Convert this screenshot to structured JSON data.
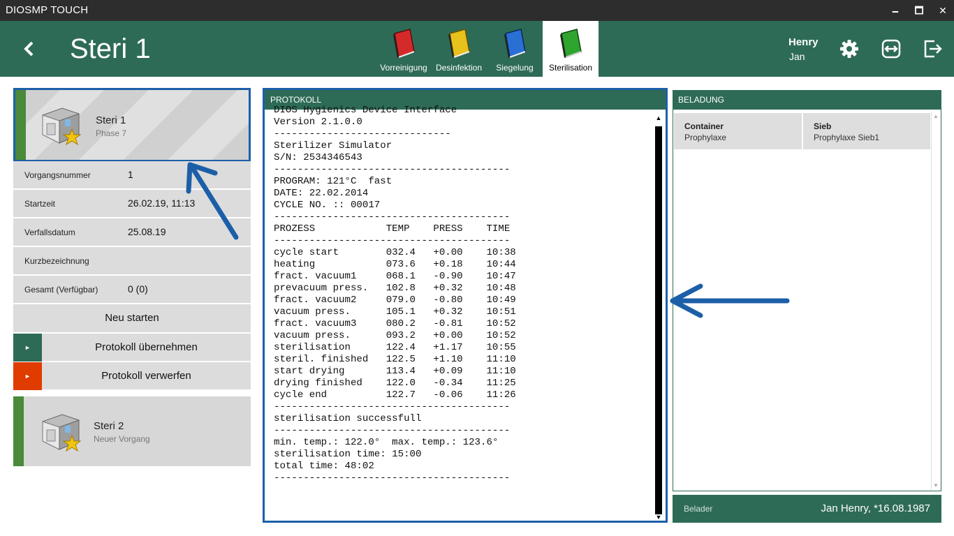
{
  "window": {
    "title": "DIOSMP TOUCH",
    "min": "🗕",
    "max": "🗖",
    "close": "✕"
  },
  "header": {
    "title": "Steri 1",
    "tabs": [
      {
        "label": "Vorreinigung",
        "color": "#d42a2a"
      },
      {
        "label": "Desinfektion",
        "color": "#e8c21c"
      },
      {
        "label": "Siegelung",
        "color": "#2a6fd4"
      },
      {
        "label": "Sterilisation",
        "color": "#2fa52f"
      }
    ],
    "user": {
      "first": "Henry",
      "last": "Jan"
    }
  },
  "left": {
    "card1": {
      "name": "Steri 1",
      "sub": "Phase 7"
    },
    "rows": [
      {
        "key": "Vorgangsnummer",
        "value": "1"
      },
      {
        "key": "Startzeit",
        "value": "26.02.19, 11:13"
      },
      {
        "key": "Verfallsdatum",
        "value": "25.08.19"
      },
      {
        "key": "Kurzbezeichnung",
        "value": ""
      },
      {
        "key": "Gesamt (Verfügbar)",
        "value": "0 (0)"
      }
    ],
    "restart": "Neu starten",
    "accept": "Protokoll übernehmen",
    "discard": "Protokoll verwerfen",
    "play": "►",
    "card2": {
      "name": "Steri 2",
      "sub": "Neuer Vorgang"
    }
  },
  "protokoll": {
    "title": "PROTOKOLL",
    "text": "DIOS Hygienics Device Interface\nVersion 2.1.0.0\n------------------------------\nSterilizer Simulator\nS/N: 2534346543\n----------------------------------------\nPROGRAM: 121°C  fast\nDATE: 22.02.2014\nCYCLE NO. :: 00017\n----------------------------------------\nPROZESS            TEMP    PRESS    TIME\n----------------------------------------\ncycle start        032.4   +0.00    10:38\nheating            073.6   +0.18    10:44\nfract. vacuum1     068.1   -0.90    10:47\nprevacuum press.   102.8   +0.32    10:48\nfract. vacuum2     079.0   -0.80    10:49\nvacuum press.      105.1   +0.32    10:51\nfract. vacuum3     080.2   -0.81    10:52\nvacuum press.      093.2   +0.00    10:52\nsterilisation      122.4   +1.17    10:55\nsteril. finished   122.5   +1.10    11:10\nstart drying       113.4   +0.09    11:10\ndrying finished    122.0   -0.34    11:25\ncycle end          122.7   -0.06    11:26\n----------------------------------------\nsterilisation successfull\n----------------------------------------\nmin. temp.: 122.0°  max. temp.: 123.6°\nsterilisation time: 15:00\ntotal time: 48:02\n----------------------------------------",
    "scroll_up": "▲",
    "scroll_down": "▼"
  },
  "beladung": {
    "title": "BELADUNG",
    "cells": [
      {
        "header": "Container",
        "value": "Prophylaxe"
      },
      {
        "header": "Sieb",
        "value": "Prophylaxe Sieb1"
      }
    ],
    "scroll_up": "▲",
    "scroll_down": "▼"
  },
  "belader": {
    "label": "Belader",
    "value": "Jan Henry, *16.08.1987"
  },
  "colors": {
    "header": "#2e6b57",
    "accent_blue": "#1c5fa8",
    "green_stripe": "#4a8a3a",
    "discard_red": "#e03c00"
  }
}
